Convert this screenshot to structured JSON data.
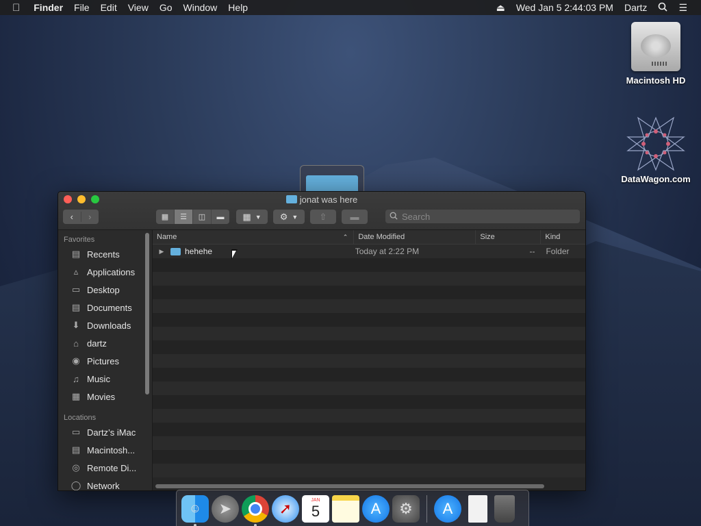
{
  "menubar": {
    "apple": "",
    "app_name": "Finder",
    "menus": [
      "File",
      "Edit",
      "View",
      "Go",
      "Window",
      "Help"
    ],
    "datetime": "Wed Jan 5  2:44:03 PM",
    "user": "Dartz"
  },
  "desktop": {
    "icons": [
      {
        "label": "Macintosh HD",
        "icon": "hard-drive-icon"
      },
      {
        "label": "DataWagon.com",
        "icon": "geometric-star-icon"
      }
    ]
  },
  "window": {
    "title": "jonat was here",
    "search_placeholder": "Search",
    "sidebar": {
      "favorites_header": "Favorites",
      "favorites": [
        {
          "label": "Recents",
          "icon": "clock-icon"
        },
        {
          "label": "Applications",
          "icon": "applications-icon"
        },
        {
          "label": "Desktop",
          "icon": "desktop-icon"
        },
        {
          "label": "Documents",
          "icon": "document-icon"
        },
        {
          "label": "Downloads",
          "icon": "download-icon"
        },
        {
          "label": "dartz",
          "icon": "home-icon"
        },
        {
          "label": "Pictures",
          "icon": "camera-icon"
        },
        {
          "label": "Music",
          "icon": "music-note-icon"
        },
        {
          "label": "Movies",
          "icon": "film-icon"
        }
      ],
      "locations_header": "Locations",
      "locations": [
        {
          "label": "Dartz’s iMac",
          "icon": "computer-icon"
        },
        {
          "label": "Macintosh...",
          "icon": "disk-icon"
        },
        {
          "label": "Remote Di...",
          "icon": "remote-disc-icon"
        },
        {
          "label": "Network",
          "icon": "globe-icon"
        }
      ]
    },
    "columns": {
      "name": "Name",
      "date": "Date Modified",
      "size": "Size",
      "kind": "Kind"
    },
    "files": [
      {
        "name": "hehehe",
        "date": "Today at 2:22 PM",
        "size": "--",
        "kind": "Folder"
      }
    ]
  },
  "dock": {
    "apps": [
      {
        "name": "Finder",
        "icon": "finder-icon",
        "running": true
      },
      {
        "name": "Launchpad",
        "icon": "rocket-icon",
        "running": false
      },
      {
        "name": "Chrome",
        "icon": "chrome-icon",
        "running": true
      },
      {
        "name": "Safari",
        "icon": "compass-icon",
        "running": false
      },
      {
        "name": "Calendar",
        "icon": "calendar-icon",
        "running": false,
        "day": "5",
        "month": "JAN"
      },
      {
        "name": "Notes",
        "icon": "notes-icon",
        "running": false
      },
      {
        "name": "App Store",
        "icon": "app-store-icon",
        "running": false
      },
      {
        "name": "System Preferences",
        "icon": "gear-icon",
        "running": false
      },
      {
        "name": "Applications Folder",
        "icon": "app-store-icon",
        "running": false
      },
      {
        "name": "Document",
        "icon": "blank-document-icon",
        "running": false
      },
      {
        "name": "Trash",
        "icon": "trash-icon",
        "running": false
      }
    ]
  }
}
